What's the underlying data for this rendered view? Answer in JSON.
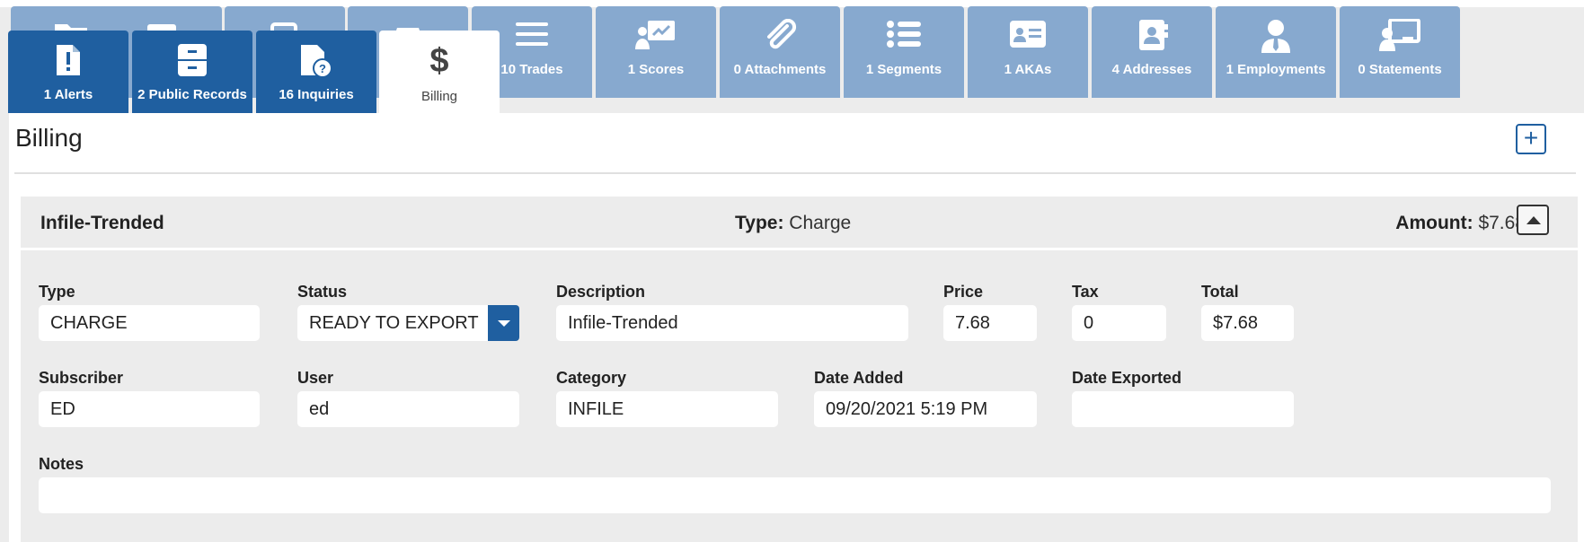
{
  "tabs_back": [
    {
      "label": "",
      "icon": "folder-icon"
    },
    {
      "label": "",
      "icon": "inbox-icon"
    },
    {
      "label": "",
      "icon": "copy-icon"
    },
    {
      "label": "",
      "icon": "car-icon"
    },
    {
      "label": "10 Trades",
      "icon": "menu-lines-icon"
    },
    {
      "label": "1 Scores",
      "icon": "presentation-chart-icon"
    },
    {
      "label": "0 Attachments",
      "icon": "paperclip-icon"
    },
    {
      "label": "1 Segments",
      "icon": "list-icon"
    },
    {
      "label": "1 AKAs",
      "icon": "id-card-icon"
    },
    {
      "label": "4 Addresses",
      "icon": "address-book-icon"
    },
    {
      "label": "1 Employments",
      "icon": "user-tie-icon"
    },
    {
      "label": "0 Statements",
      "icon": "chalkboard-user-icon"
    }
  ],
  "tabs_front": [
    {
      "label": "1 Alerts",
      "icon": "file-alert-icon"
    },
    {
      "label": "2 Public Records",
      "icon": "file-cabinet-icon"
    },
    {
      "label": "16 Inquiries",
      "icon": "file-question-icon"
    }
  ],
  "active_tab": {
    "label": "Billing",
    "icon": "dollar-icon"
  },
  "panel": {
    "title": "Billing",
    "add_symbol": "+"
  },
  "card": {
    "name": "Infile-Trended",
    "type_label": "Type:",
    "type_value": "Charge",
    "amount_label": "Amount:",
    "amount_value": "$7.68"
  },
  "fields": {
    "type": {
      "label": "Type",
      "value": "CHARGE"
    },
    "status": {
      "label": "Status",
      "value": "READY TO EXPORT"
    },
    "description": {
      "label": "Description",
      "value": "Infile-Trended"
    },
    "price": {
      "label": "Price",
      "value": "7.68"
    },
    "tax": {
      "label": "Tax",
      "value": "0"
    },
    "total": {
      "label": "Total",
      "value": "$7.68"
    },
    "subscriber": {
      "label": "Subscriber",
      "value": "ED"
    },
    "user": {
      "label": "User",
      "value": "ed"
    },
    "category": {
      "label": "Category",
      "value": "INFILE"
    },
    "date_added": {
      "label": "Date Added",
      "value": "09/20/2021 5:19 PM"
    },
    "date_exported": {
      "label": "Date Exported",
      "value": ""
    },
    "notes": {
      "label": "Notes",
      "value": ""
    }
  },
  "colors": {
    "tab_back": "#87a9cf",
    "tab_front": "#1f5fa0",
    "accent": "#1f5fa0"
  }
}
